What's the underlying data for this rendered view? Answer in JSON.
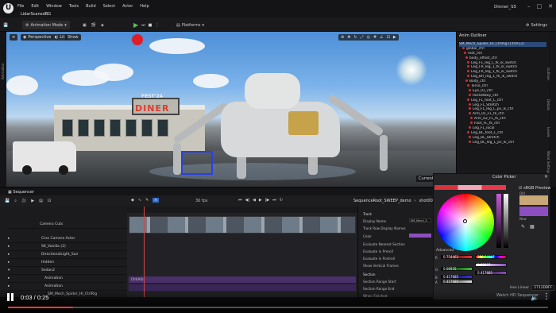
{
  "app": {
    "project_name": "Dinner_S5",
    "level_tab": "LidarScanedBG",
    "menu": [
      "File",
      "Edit",
      "Window",
      "Tools",
      "Build",
      "Select",
      "Actor",
      "Help"
    ],
    "window_controls": [
      "–",
      "□",
      "✕"
    ]
  },
  "toolbar": {
    "mode": "Animation Mode",
    "platforms": "Platforms",
    "settings": "Settings"
  },
  "viewport": {
    "perspective": "Perspective",
    "lit": "Lit",
    "show": "Show",
    "sign_top": "FEST'24",
    "sign_main": "DINER",
    "camera_label": "Current"
  },
  "left_strip": {
    "label": "Animation"
  },
  "outliner": {
    "title": "Anim Outliner",
    "items": [
      "SM_Mech_Spider_HI_CtrlRig (CtrlA12)",
      "global_ctrl",
      "root_ctrl",
      "body_offset_ctrl",
      "Leg_FL_leg_L_fk_ik_switch",
      "Leg_FR_leg_1_fk_ik_switch",
      "Leg_FR_leg_1_fk_ik_switch",
      "Leg_BR_leg_1_fk_ik_switch",
      "Body_ctrl",
      "Torso_ctrl",
      "Eye_02_ctrl",
      "RocketBay_ctrl",
      "Leg_FL_foot_L_ctrl",
      "Leg_FL_Stretch",
      "Leg_FL_leg_L_pv_ik_ctrl",
      "Arm_01_FL_fk_ctrl",
      "Arm_02_FL_fk_ctrl",
      "Foot_FL_fk_ctrl",
      "Leg_FL_local",
      "Leg_BL_foot_L_ctrl",
      "Leg_BL_Stretch",
      "Leg_BL_leg_L_pv_ik_ctrl"
    ]
  },
  "right_strip": {
    "labels": [
      "Outliner",
      "Details",
      "Levels",
      "World Settings"
    ]
  },
  "sequencer": {
    "tab": "Sequencer",
    "add": "+Add",
    "fps": "30 fps",
    "breadcrumb": "SequenceRoot_SWEEP_demo",
    "shot": "shot0010_0",
    "tracks": [
      "Camera Cuts",
      "Cine Camera Actor",
      "SK_Vanilla (2)",
      "DirectionalLight_Sun",
      "Hidden",
      "Sedan2",
      "Animation",
      "Animation",
      "SM_Mech_Spider_HI_CtrlRig"
    ],
    "clip_label": "Ctrl(A4)"
  },
  "details": {
    "section_track": "Track",
    "rows": [
      "Display Name",
      "Track Row Display Names",
      "Color",
      "Evaluate Nearest Section",
      "Evaluate in Preroll",
      "Evaluate in Postroll",
      "Show Vertical Frames"
    ],
    "display_name_value": "SM_Mech_S",
    "section_section": "Section",
    "section_rows": [
      "Section Range Start",
      "Section Range End",
      "When Finished"
    ]
  },
  "color_picker": {
    "title": "Color Picker",
    "srgb": "sRGB Preview",
    "old_label": "Old",
    "new_label": "New",
    "advanced": "Advanced",
    "rgb_values": [
      "0.754463",
      "0.06935",
      "0.417685"
    ],
    "hsv_values": [
      "256.64447",
      "0.83937",
      "0.417685"
    ],
    "extra_value": "0.417685",
    "hex_label": "Hex Linear",
    "hex_value": "2712D8FF",
    "colors": {
      "old": "#c8a876",
      "new": "#8c4ec0"
    }
  },
  "video": {
    "time": "0:03 / 0:25",
    "progress_fraction": 0.12,
    "watermark": "Watch HD Sequencer"
  },
  "colors": {
    "accent": "#2b4b7a",
    "progress": "#ff3b3b",
    "play": "#5ec15a"
  }
}
